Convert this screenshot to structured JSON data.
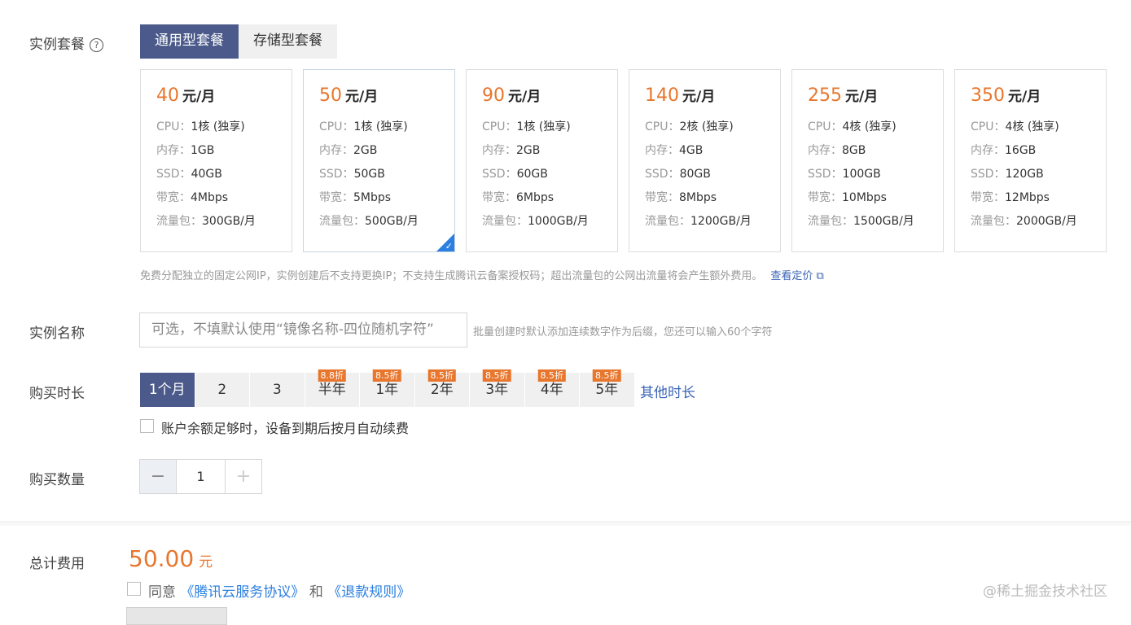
{
  "package": {
    "label": "实例套餐",
    "help_icon": "?",
    "tabs": [
      {
        "label": "通用型套餐",
        "active": true
      },
      {
        "label": "存储型套餐",
        "active": false
      }
    ],
    "plans": [
      {
        "price": "40",
        "unit": "元/月",
        "cpu": "1核 (独享)",
        "mem": "1GB",
        "ssd": "40GB",
        "bw": "4Mbps",
        "traffic": "300GB/月",
        "selected": false
      },
      {
        "price": "50",
        "unit": "元/月",
        "cpu": "1核 (独享)",
        "mem": "2GB",
        "ssd": "50GB",
        "bw": "5Mbps",
        "traffic": "500GB/月",
        "selected": true
      },
      {
        "price": "90",
        "unit": "元/月",
        "cpu": "1核 (独享)",
        "mem": "2GB",
        "ssd": "60GB",
        "bw": "6Mbps",
        "traffic": "1000GB/月",
        "selected": false
      },
      {
        "price": "140",
        "unit": "元/月",
        "cpu": "2核 (独享)",
        "mem": "4GB",
        "ssd": "80GB",
        "bw": "8Mbps",
        "traffic": "1200GB/月",
        "selected": false
      },
      {
        "price": "255",
        "unit": "元/月",
        "cpu": "4核 (独享)",
        "mem": "8GB",
        "ssd": "100GB",
        "bw": "10Mbps",
        "traffic": "1500GB/月",
        "selected": false
      },
      {
        "price": "350",
        "unit": "元/月",
        "cpu": "4核 (独享)",
        "mem": "16GB",
        "ssd": "120GB",
        "bw": "12Mbps",
        "traffic": "2000GB/月",
        "selected": false
      }
    ],
    "spec_labels": {
      "cpu": "CPU：",
      "mem": "内存：",
      "ssd": "SSD：",
      "bw": "带宽：",
      "traffic": "流量包："
    },
    "note": "免费分配独立的固定公网IP，实例创建后不支持更换IP；不支持生成腾讯云备案授权码；超出流量包的公网出流量将会产生额外费用。",
    "pricing_link": "查看定价",
    "external_link_icon": "⧉",
    "check_icon": "✓"
  },
  "instance_name": {
    "label": "实例名称",
    "placeholder": "可选，不填默认使用“镜像名称-四位随机字符”",
    "hint": "批量创建时默认添加连续数字作为后缀，您还可以输入60个字符"
  },
  "duration": {
    "label": "购买时长",
    "options": [
      {
        "label": "1个月",
        "badge": "",
        "active": true
      },
      {
        "label": "2",
        "badge": "",
        "active": false
      },
      {
        "label": "3",
        "badge": "",
        "active": false
      },
      {
        "label": "半年",
        "badge": "8.8折",
        "active": false
      },
      {
        "label": "1年",
        "badge": "8.5折",
        "active": false
      },
      {
        "label": "2年",
        "badge": "8.5折",
        "active": false
      },
      {
        "label": "3年",
        "badge": "8.5折",
        "active": false
      },
      {
        "label": "4年",
        "badge": "8.5折",
        "active": false
      },
      {
        "label": "5年",
        "badge": "8.5折",
        "active": false
      }
    ],
    "other_link": "其他时长",
    "auto_renew": "账户余额足够时，设备到期后按月自动续费"
  },
  "quantity": {
    "label": "购买数量",
    "minus": "−",
    "value": "1",
    "plus": "+"
  },
  "total": {
    "label": "总计费用",
    "amount": "50.00",
    "unit": "元",
    "agree_prefix": "同意",
    "agreement_link": "《腾讯云服务协议》",
    "and": "和",
    "refund_link": "《退款规则》"
  },
  "watermark": "@稀土掘金技术社区",
  "colors": {
    "accent": "#e8762c",
    "tab_active": "#4b5a8a",
    "link": "#3a64b7"
  }
}
